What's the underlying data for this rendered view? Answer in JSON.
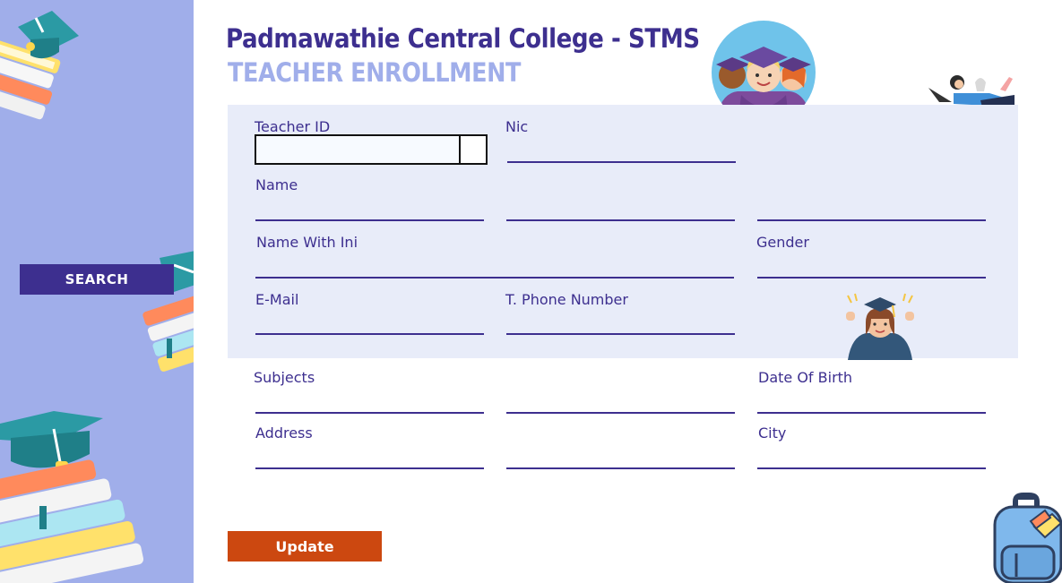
{
  "header": {
    "title": "Padmawathie Central College - STMS",
    "subtitle": "TEACHER ENROLLMENT"
  },
  "sidebar": {
    "search_label": "SEARCH"
  },
  "form": {
    "teacher_id": {
      "label": "Teacher ID",
      "value": ""
    },
    "nic": {
      "label": "Nic",
      "value": ""
    },
    "name": {
      "label": "Name",
      "first": "",
      "middle": "",
      "last": ""
    },
    "name_with_ini": {
      "label": "Name With Ini",
      "value": ""
    },
    "gender": {
      "label": "Gender",
      "value": ""
    },
    "email": {
      "label": "E-Mail",
      "value": ""
    },
    "phone": {
      "label": "T. Phone Number",
      "value": ""
    },
    "subjects": {
      "label": "Subjects",
      "value1": "",
      "value2": ""
    },
    "dob": {
      "label": "Date Of Birth",
      "value": ""
    },
    "address": {
      "label": "Address",
      "line1": "",
      "line2": ""
    },
    "city": {
      "label": "City",
      "value": ""
    }
  },
  "actions": {
    "update_label": "Update"
  },
  "colors": {
    "primary": "#3d2f8f",
    "sidebar": "#a0aeea",
    "panel": "#e8ecf9",
    "update": "#cc4810"
  },
  "icons": [
    "books-graduation-cap-icon",
    "graduates-avatar-icon",
    "girl-laptop-icon",
    "graduate-girl-icon",
    "backpack-icon"
  ]
}
